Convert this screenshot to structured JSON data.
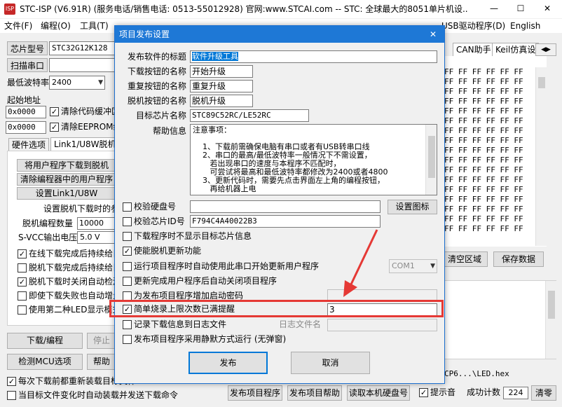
{
  "app": {
    "title": "STC-ISP (V6.91R) (服务电话/销售电话: 0513-55012928) 官网:www.STCAI.com  -- STC: 全球最大的8051单片机设...",
    "menu": [
      "文件(F)",
      "编程(O)",
      "工具(T)",
      "帮...",
      "STC..?...",
      "...",
      "...",
      "...",
      "...",
      "...",
      "...",
      "USB驱动程序(D)",
      "English"
    ],
    "menu_visible": {
      "file": "文件(F)",
      "program": "编程(O)",
      "tools": "工具(T)",
      "usb": "USB驱动程序(D)",
      "english": "English"
    }
  },
  "left": {
    "chip_label": "芯片型号",
    "chip_value": "STC32G12K128",
    "scan_port": "扫描串口",
    "min_baud_label": "最低波特率",
    "min_baud_value": "2400",
    "start_addr_label": "起始地址",
    "addr1": "0x0000",
    "addr2": "0x0000",
    "clear_code_buf": "清除代码缓冲区",
    "clear_eeprom_buf": "清除EEPROM缓冲区",
    "tabs": [
      "硬件选项",
      "Link1/U8W脱机"
    ],
    "btn_download_user": "将用户程序下载到脱机",
    "btn_clear_programmer": "清除编程器中的用户程序",
    "btn_set_link": "设置Link1/U8W",
    "offline_label": "设置脱机下载时的参数",
    "offline_count_label": "脱机编程数量",
    "offline_count_value": "10000",
    "svcc_label": "S-VCC输出电压",
    "svcc_value": "5.0 V",
    "options": [
      {
        "text": "在线下载完成后持续给目标",
        "checked": true
      },
      {
        "text": "脱机下载完成后持续给目标",
        "checked": false
      },
      {
        "text": "脱机下载时关闭自动检测",
        "checked": true
      },
      {
        "text": "即使下载失败也自动增量",
        "checked": false
      },
      {
        "text": "使用第二种LED显示模式",
        "checked": false
      }
    ],
    "btn_download": "下载/编程",
    "btn_stop": "停止",
    "btn_detect": "检测MCU选项",
    "btn_help": "帮助",
    "reload_each": "每次下载前都重新装载目标文件",
    "auto_load": "当目标文件变化时自动装载并发送下载命令"
  },
  "right": {
    "tab_can": "CAN助手",
    "tab_keil": "Keil仿真设",
    "hex": "FF FF FF FF FF FF",
    "btn_clear_area": "清空区域",
    "btn_save_data": "保存数据",
    "file_path": "CP6...\\LED.hex",
    "beep_label": "提示音",
    "success_label": "成功计数",
    "success_value": "224",
    "btn_clear": "清零"
  },
  "bottom_bar": {
    "btn_publish": "发布项目程序",
    "btn_publish_help": "发布项目帮助",
    "btn_read_id": "读取本机硬盘号"
  },
  "dialog": {
    "title": "项目发布设置",
    "close": "✕",
    "fields": {
      "software_title_label": "发布软件的标题",
      "software_title_value": "软件升级工具",
      "download_btn_name_label": "下载按钮的名称",
      "download_btn_name_value": "开始升级",
      "repeat_btn_name_label": "重复按钮的名称",
      "repeat_btn_name_value": "重复升级",
      "offline_btn_name_label": "脱机按钮的名称",
      "offline_btn_name_value": "脱机升级",
      "target_chip_label": "目标芯片名称",
      "target_chip_value": "STC89C52RC/LE52RC",
      "help_label": "帮助信息"
    },
    "help_text": [
      "注意事项：",
      "",
      "    1、下载前需确保电脑有串口或者有USB转串口线",
      "    2、串口的最高/最低波特率一般情况下不需设置，",
      "       若出现串口的速度与本程序不匹配时，",
      "       可尝试将最高和最低波特率都修改为2400或者4800",
      "    3、更新代码时，需要先点击界面左上角的编程按钮，",
      "       再给机器上电"
    ],
    "verify_disk_label": "校验硬盘号",
    "verify_disk_value": "",
    "btn_set_icon": "设置图标",
    "verify_chip_label": "校验芯片ID号",
    "verify_chip_value": "F794C4A40022B3",
    "options": [
      {
        "text": "下载程序时不显示目标芯片信息",
        "checked": false
      },
      {
        "text": "使能脱机更新功能",
        "checked": true
      },
      {
        "text": "运行项目程序时自动使用此串口开始更新用户程序",
        "checked": false
      },
      {
        "text": "更新完成用户程序后自动关闭项目程序",
        "checked": false
      },
      {
        "text": "为发布项目程序增加启动密码",
        "checked": false
      }
    ],
    "com_value": "COM1",
    "password_value": "",
    "simple_limit_label": "简单烧录上限次数已满提醒",
    "simple_limit_checked": true,
    "simple_limit_value": "3",
    "log_label": "记录下载信息到日志文件",
    "log_checked": false,
    "log_file_label": "日志文件名",
    "silent_label": "发布项目程序采用静默方式运行 (无弹窗)",
    "silent_checked": false,
    "btn_publish": "发布",
    "btn_cancel": "取消"
  },
  "highlight_color": "#e53935"
}
